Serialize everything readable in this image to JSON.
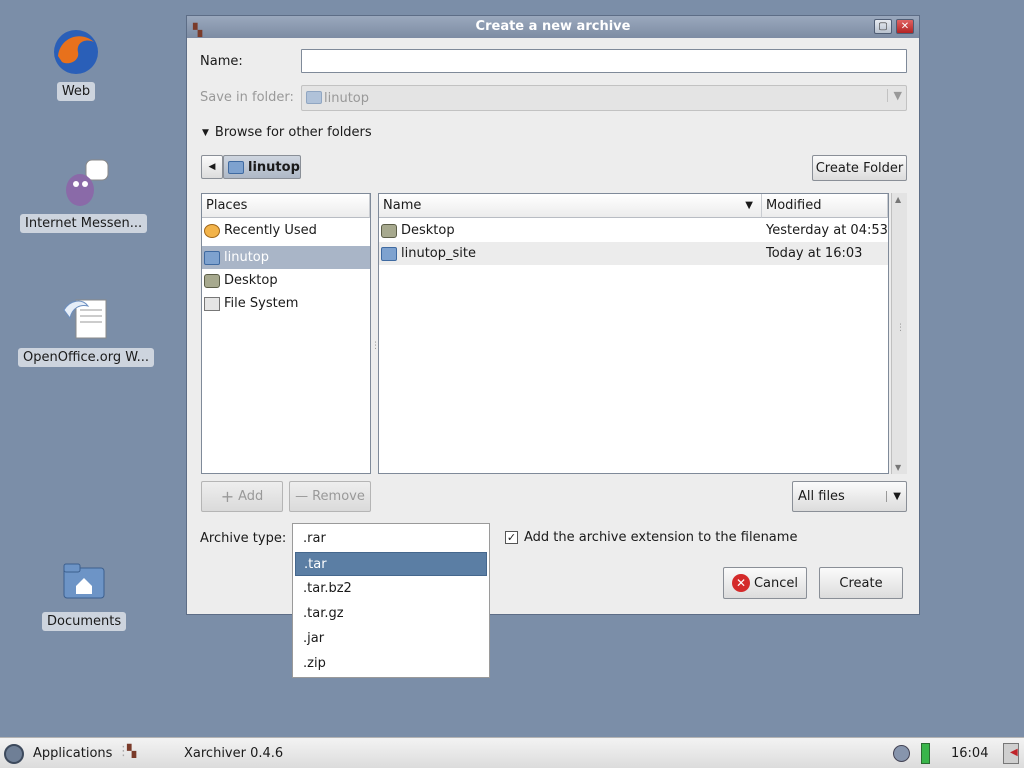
{
  "desktop": {
    "icons": [
      {
        "label": "Web"
      },
      {
        "label": "Internet Messen..."
      },
      {
        "label": "OpenOffice.org W..."
      },
      {
        "label": "Documents"
      }
    ]
  },
  "dialog": {
    "title": "Create a new archive",
    "name_label": "Name:",
    "name_value": "",
    "save_in_label": "Save in folder:",
    "save_in_value": "linutop",
    "browse_label": "Browse for other folders",
    "breadcrumb_current": "linutop",
    "create_folder_label": "Create Folder",
    "places": {
      "header": "Places",
      "items": [
        {
          "label": "Recently Used"
        },
        {
          "label": "linutop"
        },
        {
          "label": "Desktop"
        },
        {
          "label": "File System"
        }
      ]
    },
    "files": {
      "col_name": "Name",
      "col_modified": "Modified",
      "rows": [
        {
          "name": "Desktop",
          "modified": "Yesterday at 04:53"
        },
        {
          "name": "linutop_site",
          "modified": "Today at 16:03"
        }
      ]
    },
    "add_label": "Add",
    "remove_label": "Remove",
    "filter_value": "All files",
    "archive_type_label": "Archive type:",
    "archive_types": [
      ".rar",
      ".tar",
      ".tar.bz2",
      ".tar.gz",
      ".jar",
      ".zip"
    ],
    "archive_type_selected": ".tar",
    "add_extension_label": "Add the archive extension to the filename",
    "add_extension_checked": true,
    "cancel_label": "Cancel",
    "create_label": "Create"
  },
  "taskbar": {
    "applications_label": "Applications",
    "task_label": "Xarchiver 0.4.6",
    "clock": "16:04"
  },
  "colors": {
    "desktop_bg": "#7b8ea8",
    "selection": "#5b7ea4",
    "titlebar": "#8796ad"
  }
}
